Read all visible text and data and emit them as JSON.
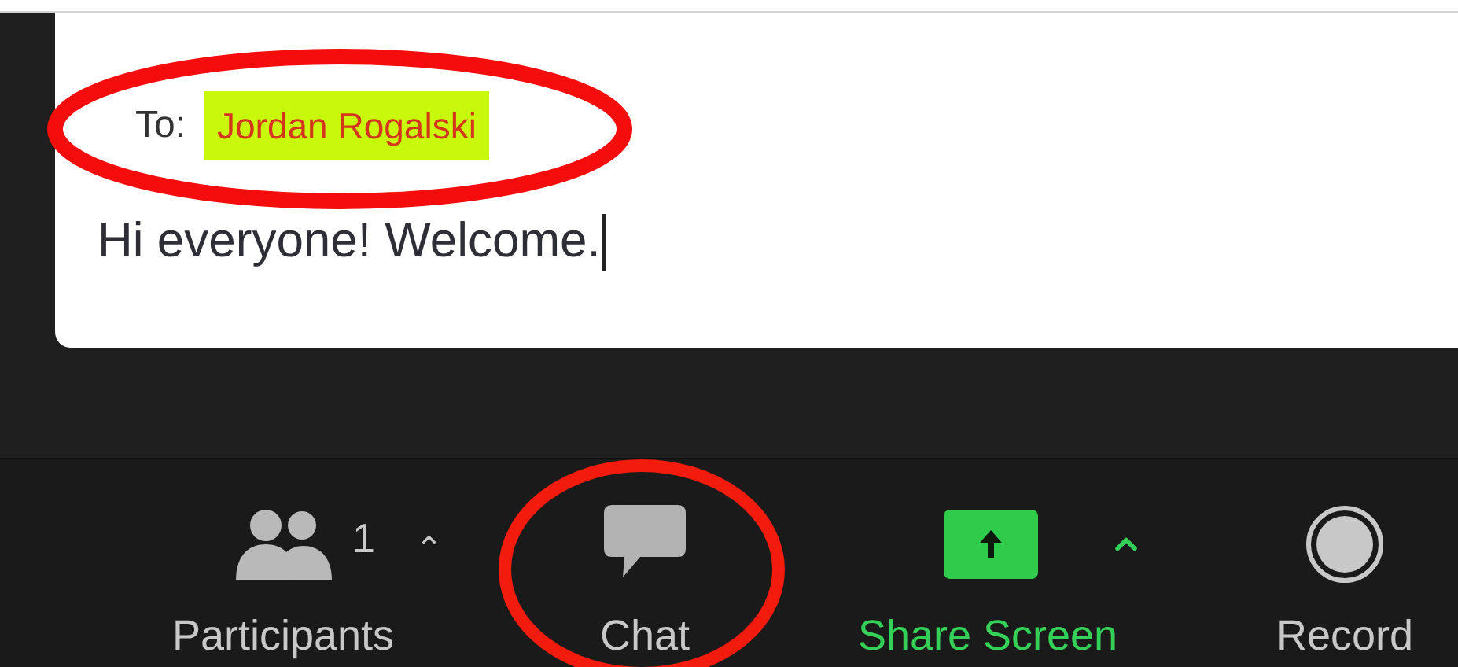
{
  "compose": {
    "to_label": "To:",
    "recipient": "Jordan Rogalski",
    "message": "Hi everyone! Welcome."
  },
  "toolbar": [
    {
      "kind": "participants",
      "label": "Participants",
      "count": "1",
      "active": false
    },
    {
      "kind": "chat",
      "label": "Chat",
      "active": false
    },
    {
      "kind": "share",
      "label": "Share Screen",
      "active": true
    },
    {
      "kind": "record",
      "label": "Record",
      "active": false
    }
  ]
}
